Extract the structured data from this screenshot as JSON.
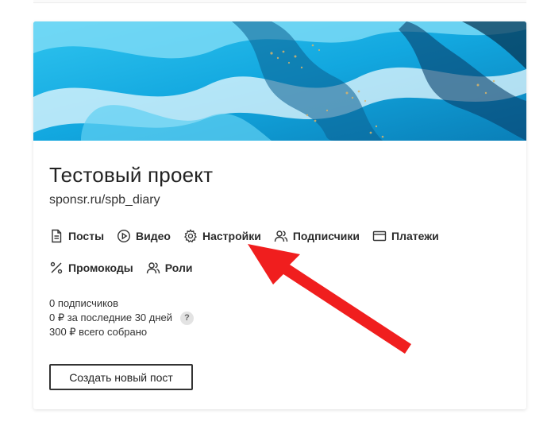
{
  "project": {
    "title": "Тестовый проект",
    "url": "sponsr.ru/spb_diary"
  },
  "nav": [
    {
      "label": "Посты",
      "icon": "document-icon"
    },
    {
      "label": "Видео",
      "icon": "play-icon"
    },
    {
      "label": "Настройки",
      "icon": "gear-icon"
    },
    {
      "label": "Подписчики",
      "icon": "users-icon"
    },
    {
      "label": "Платежи",
      "icon": "card-icon"
    },
    {
      "label": "Промокоды",
      "icon": "percent-icon"
    },
    {
      "label": "Роли",
      "icon": "roles-icon"
    }
  ],
  "stats": {
    "subscribers": "0 подписчиков",
    "last30": "0 ₽ за последние 30 дней",
    "total": "300 ₽ всего собрано",
    "help_label": "?"
  },
  "actions": {
    "create_post": "Создать новый пост"
  },
  "colors": {
    "arrow": "#f01e1e",
    "cover_primary": "#18b4e8",
    "cover_accent": "#d9b46a"
  }
}
